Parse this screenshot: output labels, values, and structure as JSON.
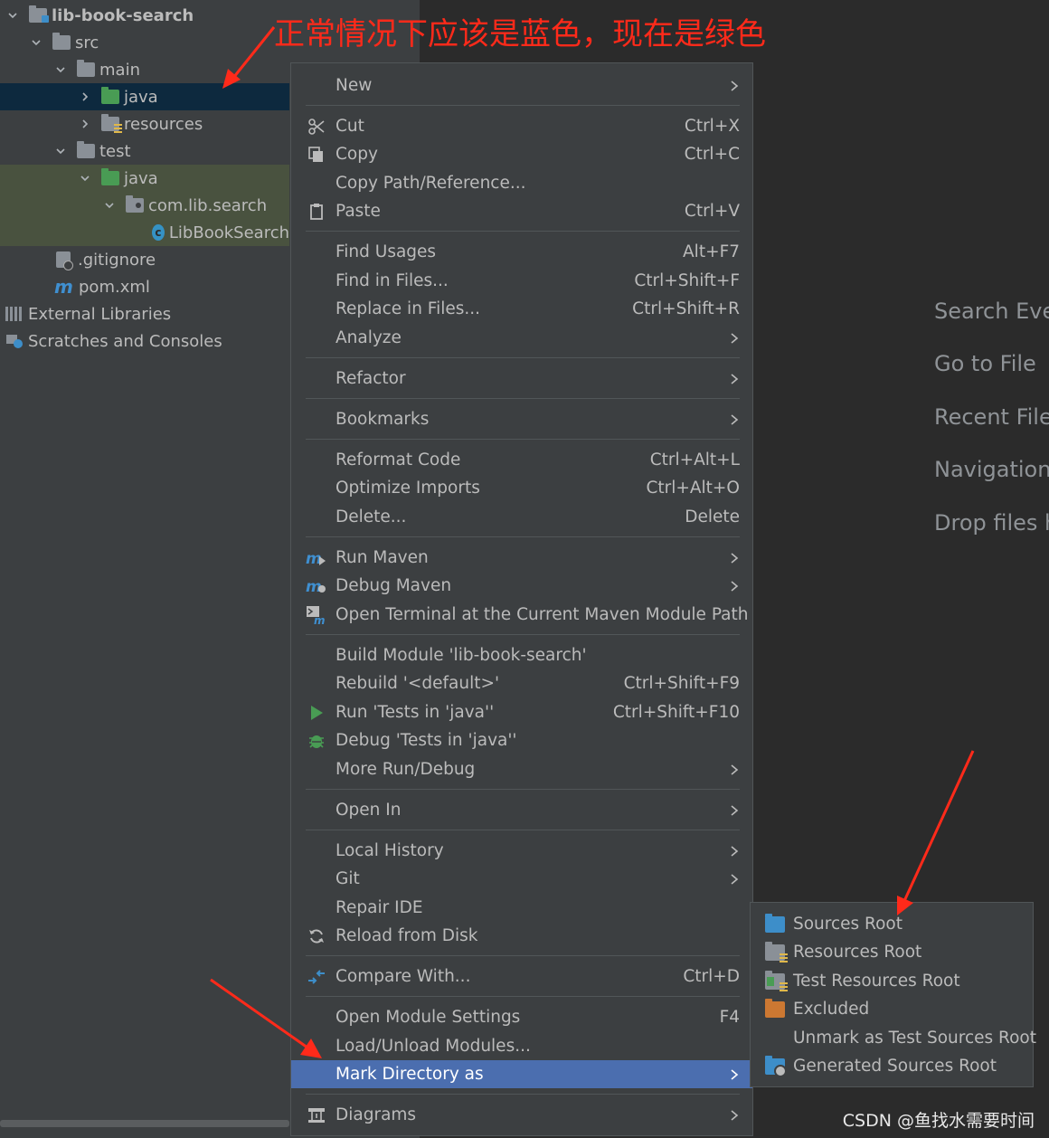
{
  "tree": {
    "items": [
      {
        "label": "lib-book-search",
        "icon": "module-folder-icon"
      },
      {
        "label": "src",
        "icon": "folder-icon"
      },
      {
        "label": "main",
        "icon": "folder-icon"
      },
      {
        "label": "java",
        "icon": "test-sources-folder-icon"
      },
      {
        "label": "resources",
        "icon": "resources-folder-icon"
      },
      {
        "label": "test",
        "icon": "folder-icon"
      },
      {
        "label": "java",
        "icon": "test-sources-folder-icon"
      },
      {
        "label": "com.lib.search",
        "icon": "package-icon"
      },
      {
        "label": "LibBookSearch",
        "icon": "class-icon"
      },
      {
        "label": ".gitignore",
        "icon": "gitignore-icon"
      },
      {
        "label": "pom.xml",
        "icon": "maven-icon"
      },
      {
        "label": "External Libraries",
        "icon": "libraries-icon"
      },
      {
        "label": "Scratches and Consoles",
        "icon": "scratches-icon"
      }
    ]
  },
  "annotation": {
    "text": "正常情况下应该是蓝色，现在是绿色",
    "color": "#ff2a1a"
  },
  "welcome": {
    "items": [
      "Search Ever",
      "Go to File",
      "Recent File",
      "Navigation",
      "Drop files h"
    ]
  },
  "context_menu": {
    "items": [
      {
        "label": "New",
        "shortcut": "",
        "submenu": true
      },
      {
        "label": "Cut",
        "shortcut": "Ctrl+X",
        "icon": "scissors-icon"
      },
      {
        "label": "Copy",
        "shortcut": "Ctrl+C",
        "icon": "copy-icon"
      },
      {
        "label": "Copy Path/Reference...",
        "shortcut": ""
      },
      {
        "label": "Paste",
        "shortcut": "Ctrl+V",
        "icon": "clipboard-icon"
      },
      {
        "label": "Find Usages",
        "shortcut": "Alt+F7"
      },
      {
        "label": "Find in Files...",
        "shortcut": "Ctrl+Shift+F"
      },
      {
        "label": "Replace in Files...",
        "shortcut": "Ctrl+Shift+R"
      },
      {
        "label": "Analyze",
        "shortcut": "",
        "submenu": true
      },
      {
        "label": "Refactor",
        "shortcut": "",
        "submenu": true
      },
      {
        "label": "Bookmarks",
        "shortcut": "",
        "submenu": true
      },
      {
        "label": "Reformat Code",
        "shortcut": "Ctrl+Alt+L"
      },
      {
        "label": "Optimize Imports",
        "shortcut": "Ctrl+Alt+O"
      },
      {
        "label": "Delete...",
        "shortcut": "Delete"
      },
      {
        "label": "Run Maven",
        "shortcut": "",
        "submenu": true,
        "icon": "run-maven-icon"
      },
      {
        "label": "Debug Maven",
        "shortcut": "",
        "submenu": true,
        "icon": "debug-maven-icon"
      },
      {
        "label": "Open Terminal at the Current Maven Module Path",
        "shortcut": "",
        "icon": "maven-terminal-icon"
      },
      {
        "label": "Build Module 'lib-book-search'",
        "shortcut": ""
      },
      {
        "label": "Rebuild '<default>'",
        "shortcut": "Ctrl+Shift+F9"
      },
      {
        "label": "Run 'Tests in 'java''",
        "shortcut": "Ctrl+Shift+F10",
        "icon": "run-icon"
      },
      {
        "label": "Debug 'Tests in 'java''",
        "shortcut": "",
        "icon": "debug-icon"
      },
      {
        "label": "More Run/Debug",
        "shortcut": "",
        "submenu": true
      },
      {
        "label": "Open In",
        "shortcut": "",
        "submenu": true
      },
      {
        "label": "Local History",
        "shortcut": "",
        "submenu": true
      },
      {
        "label": "Git",
        "shortcut": "",
        "submenu": true
      },
      {
        "label": "Repair IDE",
        "shortcut": ""
      },
      {
        "label": "Reload from Disk",
        "shortcut": "",
        "icon": "reload-icon"
      },
      {
        "label": "Compare With...",
        "shortcut": "Ctrl+D",
        "icon": "compare-icon"
      },
      {
        "label": "Open Module Settings",
        "shortcut": "F4"
      },
      {
        "label": "Load/Unload Modules...",
        "shortcut": ""
      },
      {
        "label": "Mark Directory as",
        "shortcut": "",
        "submenu": true,
        "selected": true
      },
      {
        "label": "Diagrams",
        "shortcut": "",
        "submenu": true,
        "icon": "diagram-icon"
      }
    ]
  },
  "submenu": {
    "items": [
      {
        "label": "Sources Root",
        "icon": "sources-root-icon"
      },
      {
        "label": "Resources Root",
        "icon": "resources-root-icon"
      },
      {
        "label": "Test Resources Root",
        "icon": "test-resources-root-icon"
      },
      {
        "label": "Excluded",
        "icon": "excluded-icon"
      },
      {
        "label": "Unmark as Test Sources Root",
        "icon": ""
      },
      {
        "label": "Generated Sources Root",
        "icon": "generated-sources-root-icon"
      }
    ]
  },
  "watermark": "CSDN @鱼找水需要时间"
}
